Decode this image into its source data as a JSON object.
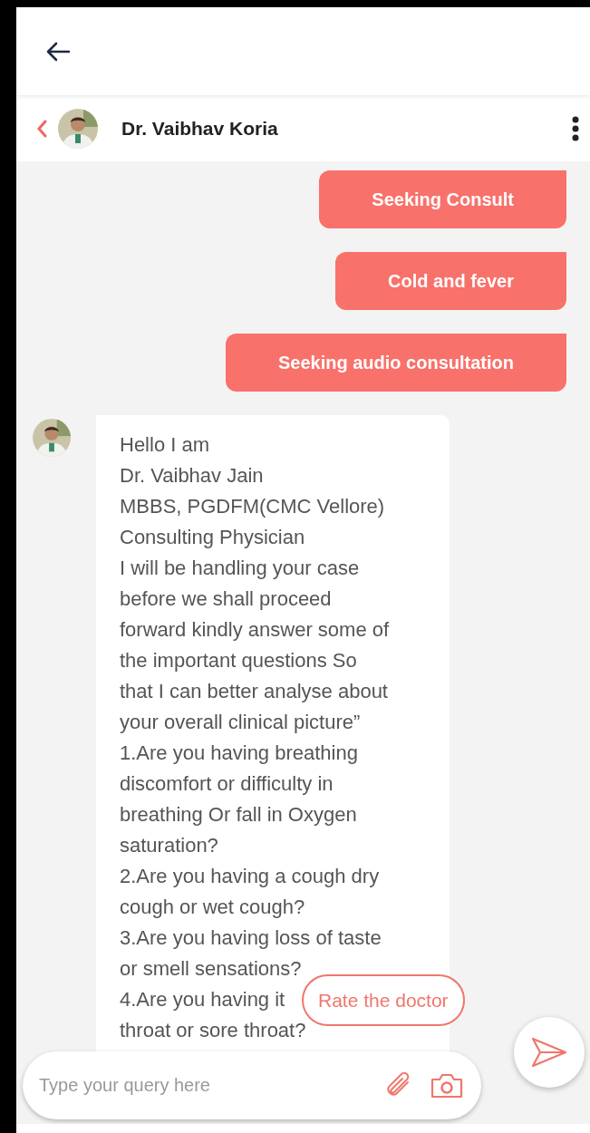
{
  "chat_header": {
    "name": "Dr. Vaibhav Koria"
  },
  "messages": [
    {
      "kind": "sent",
      "text": "Seeking Consult"
    },
    {
      "kind": "sent",
      "text": "Cold and fever"
    },
    {
      "kind": "sent",
      "text": "Seeking audio consultation"
    },
    {
      "kind": "received",
      "text": "Hello I am\nDr. Vaibhav Jain\nMBBS, PGDFM(CMC Vellore)\nConsulting Physician\nI will be handling your case\nbefore we shall proceed\nforward kindly answer some of\nthe important questions So\nthat I can better analyse about\nyour overall clinical picture”\n1.Are you having breathing\ndiscomfort or difficulty in\nbreathing Or fall in Oxygen\nsaturation?\n2.Are you having a cough dry\ncough or wet cough?\n3.Are you having loss of taste\nor smell sensations?\n4.Are you having it\nthroat or sore throat?"
    }
  ],
  "rate_button": "Rate the doctor",
  "composer": {
    "placeholder": "Type your query here"
  }
}
